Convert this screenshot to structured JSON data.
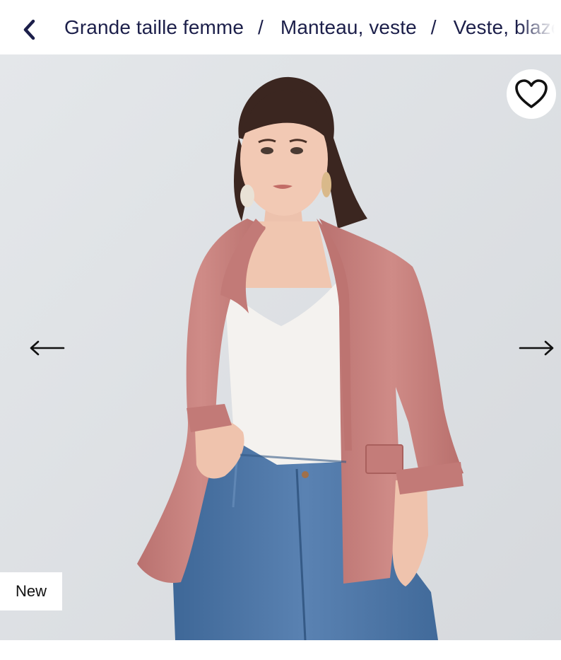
{
  "header": {
    "back_icon": "chevron-left-icon",
    "breadcrumb": [
      {
        "label": "Grande taille femme"
      },
      {
        "label": "Manteau, veste"
      },
      {
        "label": "Veste, blazer"
      }
    ],
    "separator": "/"
  },
  "gallery": {
    "favorite_icon": "heart-outline-icon",
    "prev_icon": "arrow-left-icon",
    "next_icon": "arrow-right-icon",
    "badge": "New"
  },
  "colors": {
    "breadcrumb_text": "#1c1f4a",
    "photo_background": "#dfe2e5",
    "jacket": "#c98582",
    "top": "#f4f2ef",
    "jeans": "#4d76a8"
  }
}
